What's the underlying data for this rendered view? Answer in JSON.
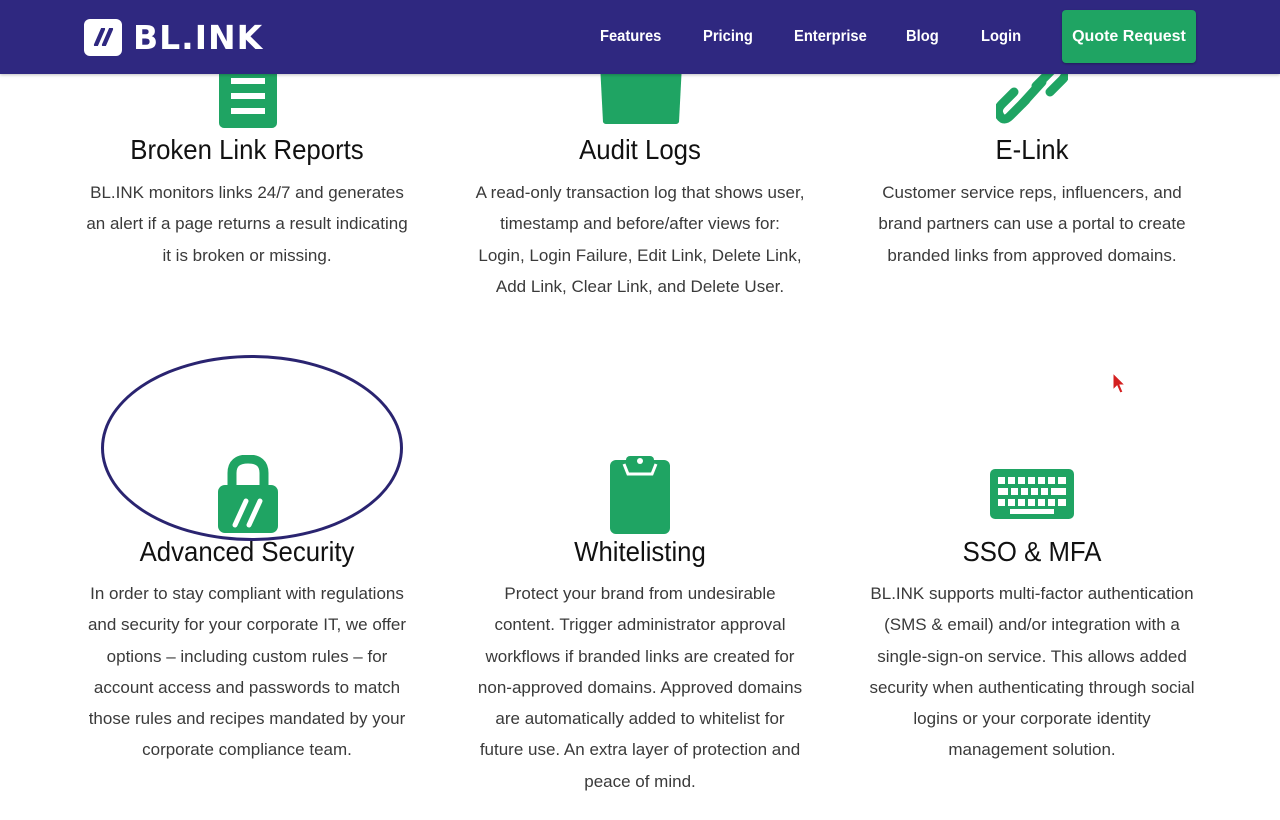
{
  "brand": {
    "logo_text": "BL.INK",
    "primary_color": "#2f2880",
    "accent_color": "#1fa463"
  },
  "nav": {
    "links": [
      {
        "label": "Features"
      },
      {
        "label": "Pricing"
      },
      {
        "label": "Enterprise"
      },
      {
        "label": "Blog"
      },
      {
        "label": "Login"
      }
    ],
    "cta_label": "Quote Request"
  },
  "features": [
    {
      "title": "Broken Link Reports",
      "icon": "report-icon",
      "description": "BL.INK monitors links 24/7 and generates an alert if a page returns a result indicating it is broken or missing."
    },
    {
      "title": "Audit Logs",
      "icon": "folder-icon",
      "description": "A read-only transaction log that shows user, timestamp and before/after views for: Login, Login Failure, Edit Link, Delete Link, Add Link, Clear Link, and Delete User."
    },
    {
      "title": "E-Link",
      "icon": "chain-link-icon",
      "description": "Customer service reps, influencers, and brand partners can use a portal to create branded links from approved domains."
    },
    {
      "title": "Advanced Security",
      "icon": "lock-icon",
      "description": "In order to stay compliant with regulations and security for your corporate IT, we offer  options – including custom rules – for account access and passwords to match those rules and recipes mandated by your corporate compliance team."
    },
    {
      "title": "Whitelisting",
      "icon": "clipboard-icon",
      "description": "Protect your brand from undesirable content. Trigger administrator approval workflows if branded links are created for non-approved domains. Approved domains are automatically added to whitelist for future use. An extra layer of protection and peace of mind."
    },
    {
      "title": "SSO & MFA",
      "icon": "keyboard-icon",
      "description": "BL.INK supports multi-factor authentication (SMS & email) and/or integration with a single-sign-on service. This allows added security when authenticating through social logins or your corporate identity management solution."
    }
  ]
}
